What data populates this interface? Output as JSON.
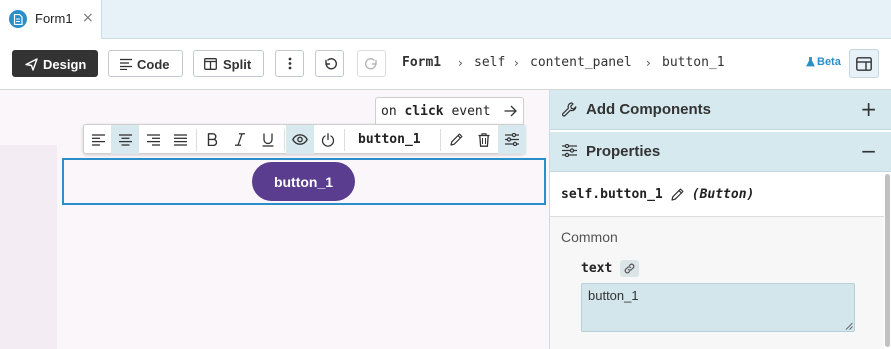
{
  "tabs": [
    {
      "label": "Form1",
      "close": "×",
      "icon": "form-icon"
    }
  ],
  "toolbar": {
    "design_label": "Design",
    "code_label": "Code",
    "split_label": "Split",
    "more_icon": "more-vertical-icon",
    "undo_icon": "undo-icon",
    "redo_icon": "redo-icon",
    "beta_label": "Beta",
    "layout_icon": "layout-icon"
  },
  "breadcrumb": {
    "form": "Form1",
    "items": [
      "self",
      "content_panel",
      "button_1"
    ],
    "separator": "›"
  },
  "canvas": {
    "event_prefix": "on ",
    "event_keyword": "click",
    "event_suffix": " event",
    "component_name": "button_1",
    "button_text": "button_1",
    "button_color": "#5a3d8f",
    "selection_color": "#2a8fc9"
  },
  "format_toolbar": {
    "tools": [
      "align-left",
      "align-center",
      "align-right",
      "align-justify",
      "bold",
      "italic",
      "underline",
      "visible",
      "enabled",
      "rename",
      "delete",
      "properties"
    ],
    "active": [
      "align-center",
      "visible",
      "properties"
    ]
  },
  "panel": {
    "add_components": "Add Components",
    "add_action": "+",
    "properties": "Properties",
    "properties_action": "−",
    "object_name": "self.button_1",
    "object_type": "(Button)",
    "section": "Common",
    "text_label": "text",
    "text_value": "button_1"
  },
  "colors": {
    "accent": "#2a8fc9",
    "panel_header": "#d6e9ef",
    "design_button": "#333333"
  }
}
